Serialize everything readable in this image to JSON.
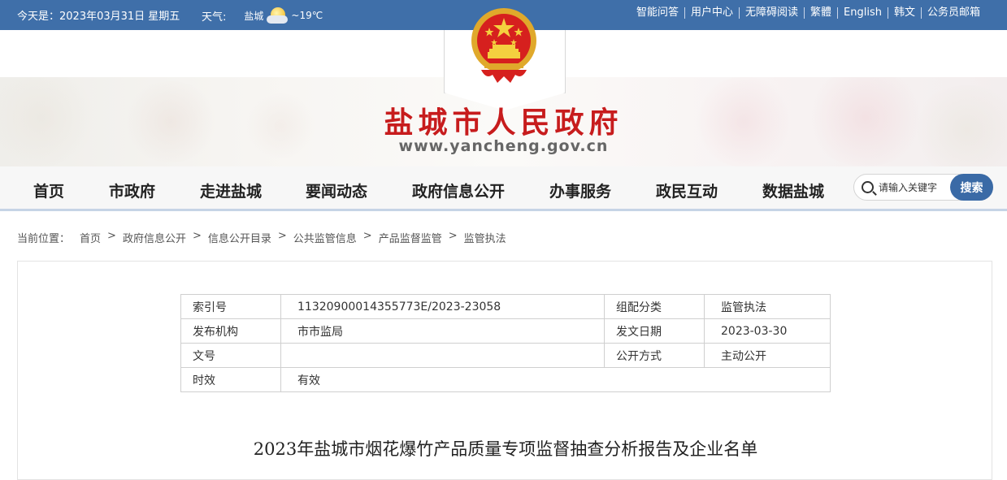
{
  "topbar": {
    "date": "今天是：2023年03月31日 星期五",
    "weather_label": "天气:",
    "weather_city": "盐城",
    "weather_temp": "~19℃",
    "links": [
      "智能问答",
      "用户中心",
      "无障碍阅读",
      "繁體",
      "English",
      "韩文",
      "公务员邮箱"
    ]
  },
  "header": {
    "title": "盐城市人民政府",
    "url": "www.yancheng.gov.cn"
  },
  "nav": {
    "items": [
      "首页",
      "市政府",
      "走进盐城",
      "要闻动态",
      "政府信息公开",
      "办事服务",
      "政民互动",
      "数据盐城"
    ],
    "search_placeholder": "请输入关键字",
    "search_button": "搜索"
  },
  "breadcrumb": {
    "label": "当前位置：",
    "items": [
      "首页",
      "政府信息公开",
      "信息公开目录",
      "公共监管信息",
      "产品监督监管",
      "监管执法"
    ],
    "separator": ">"
  },
  "meta": {
    "rows": [
      {
        "k1": "索引号",
        "v1": "11320900014355773E/2023-23058",
        "k2": "组配分类",
        "v2": "监管执法"
      },
      {
        "k1": "发布机构",
        "v1": "市市监局",
        "k2": "发文日期",
        "v2": "2023-03-30"
      },
      {
        "k1": "文号",
        "v1": "",
        "k2": "公开方式",
        "v2": "主动公开"
      },
      {
        "k1": "时效",
        "v1": "有效"
      }
    ]
  },
  "document": {
    "title": "2023年盐城市烟花爆竹产品质量专项监督抽查分析报告及企业名单"
  },
  "colors": {
    "topbar": "#3f6fa9",
    "title_red": "#c71c1d",
    "search_button": "#3a6aa6"
  }
}
